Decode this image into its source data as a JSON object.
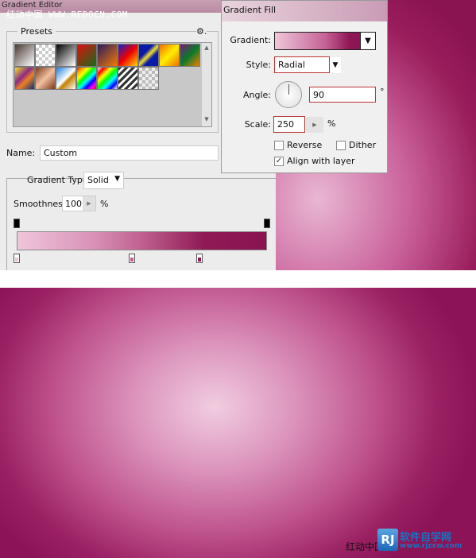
{
  "gradient_editor": {
    "title": "Gradient Editor",
    "watermark": "红动中国 WWW.REDOCN.COM",
    "presets_label": "Presets",
    "gear_icon": "gear-icon",
    "preset_swatches": [
      "linear-gradient(135deg,#4a3a34,#fff)",
      "repeating-conic-gradient(#ccc 0 25%,#fff 0 50%) 0 0/8px 8px",
      "linear-gradient(135deg,#000,#fff)",
      "linear-gradient(135deg,#d11,#186a18)",
      "linear-gradient(135deg,#2a1a60,#f07a00)",
      "linear-gradient(135deg,#1122cc,#e00 50%,#ffd800)",
      "linear-gradient(135deg,#0a1aa8 35%,#f2e02a 50%,#0a1aa8 65%)",
      "linear-gradient(135deg,#f07000,#ffee00 50%,#f07000)",
      "linear-gradient(135deg,#7a1a7a,#0a7a2a 50%,#f08000)",
      "linear-gradient(135deg,#f2e020,#8a2a8a 40%,#f08020 60%,#0a3080)",
      "linear-gradient(135deg,#7a3a1a,#f2c0a0 50%,#7a3a1a)",
      "linear-gradient(135deg,#1a80e0,#fff 50%,#c08000 60%,#fff)",
      "linear-gradient(135deg,red,orange,yellow,lime,cyan,blue,magenta,red)",
      "linear-gradient(135deg,#fff,red,yellow,lime,cyan,blue,#fff)",
      "repeating-linear-gradient(135deg,#333 0 3px,#fff 3px 6px)",
      "repeating-conic-gradient(#bbb 0 25%,#eee 0 50%) 0 0/8px 8px"
    ],
    "name_label": "Name:",
    "name_value": "Custom",
    "gradient_type_label": "Gradient Type:",
    "gradient_type_value": "Solid",
    "smoothness_label": "Smoothness:",
    "smoothness_value": "100",
    "smoothness_unit": "%",
    "opacity_stops_percent": [
      0,
      100
    ],
    "color_stops": [
      {
        "location_percent": 0,
        "color": "#efc6da"
      },
      {
        "location_percent": 46,
        "color": "#c06090"
      },
      {
        "location_percent": 73,
        "color": "#8e1a55"
      }
    ]
  },
  "gradient_fill": {
    "title": "Gradient Fill",
    "gradient_label": "Gradient:",
    "style_label": "Style:",
    "style_value": "Radial",
    "angle_label": "Angle:",
    "angle_value": "90",
    "angle_unit": "°",
    "scale_label": "Scale:",
    "scale_value": "250",
    "scale_unit": "%",
    "reverse_label": "Reverse",
    "reverse_checked": false,
    "dither_label": "Dither",
    "dither_checked": false,
    "align_label": "Align with layer",
    "align_checked": true
  },
  "footer": {
    "credit": "红动中国",
    "logo_mark": "RJ",
    "logo_name": "软件自学网",
    "logo_url": "www.rjzxw.com"
  },
  "colors": {
    "accent": "#8a1352",
    "light": "#efc6da"
  }
}
